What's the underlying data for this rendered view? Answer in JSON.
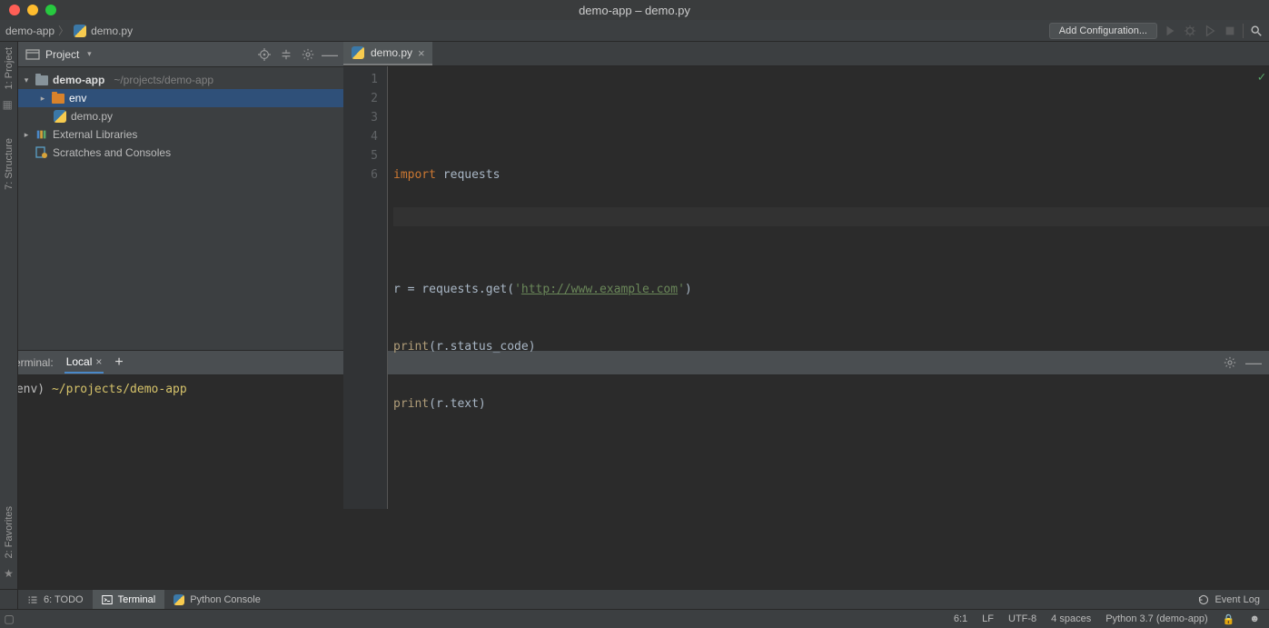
{
  "window": {
    "title": "demo-app – demo.py"
  },
  "breadcrumbs": {
    "project": "demo-app",
    "file": "demo.py"
  },
  "toolbar": {
    "add_config": "Add Configuration..."
  },
  "left_rail": {
    "project": "1: Project",
    "structure": "7: Structure",
    "favorites": "2: Favorites"
  },
  "project_panel": {
    "title": "Project",
    "root": {
      "name": "demo-app",
      "path": "~/projects/demo-app"
    },
    "env": "env",
    "file": "demo.py",
    "ext_libs": "External Libraries",
    "scratches": "Scratches and Consoles"
  },
  "editor": {
    "tab": "demo.py",
    "gutter": [
      "1",
      "2",
      "3",
      "4",
      "5",
      "6"
    ],
    "lines": {
      "l1_kw": "import",
      "l1_id": " requests",
      "l3_a": "r = requests.get(",
      "l3_q1": "'",
      "l3_url": "http://www.example.com",
      "l3_q2": "'",
      "l3_b": ")",
      "l4_fn": "print",
      "l4_rest": "(r.status_code)",
      "l5_fn": "print",
      "l5_rest": "(r.text)"
    }
  },
  "terminal": {
    "label": "Terminal:",
    "tab": "Local",
    "plus": "+",
    "prompt_env": "(env) ",
    "prompt_path": "~/projects/demo-app",
    "caret": "→"
  },
  "bottom_tabs": {
    "todo": "6: TODO",
    "terminal": "Terminal",
    "pyconsole": "Python Console",
    "event_log": "Event Log"
  },
  "status": {
    "pos": "6:1",
    "le": "LF",
    "enc": "UTF-8",
    "indent": "4 spaces",
    "interp": "Python 3.7 (demo-app)"
  }
}
